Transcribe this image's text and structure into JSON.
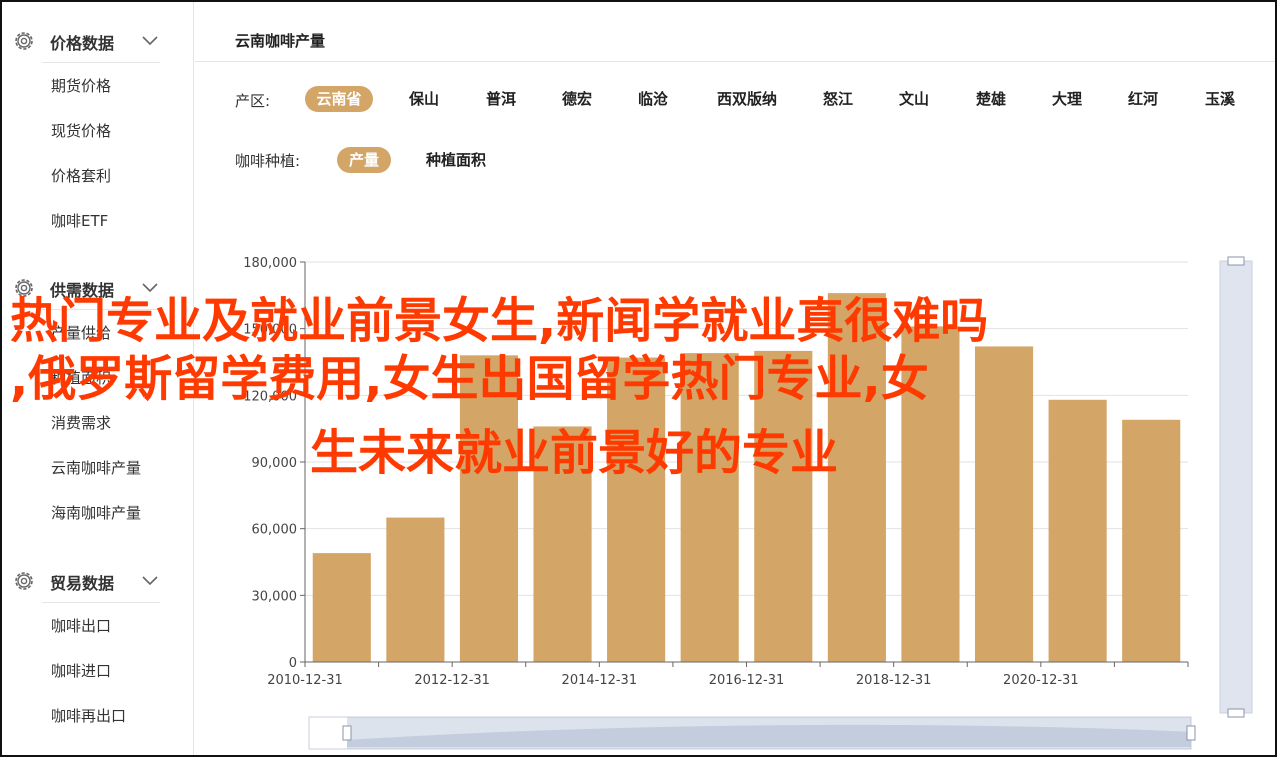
{
  "sidebar": {
    "sections": [
      {
        "title": "价格数据",
        "items": [
          "期货价格",
          "现货价格",
          "价格套利",
          "咖啡ETF"
        ]
      },
      {
        "title": "供需数据",
        "items": [
          "产量供给",
          "种植面积",
          "消费需求",
          "云南咖啡产量",
          "海南咖啡产量"
        ]
      },
      {
        "title": "贸易数据",
        "items": [
          "咖啡出口",
          "咖啡进口",
          "咖啡再出口"
        ]
      }
    ]
  },
  "main": {
    "title": "云南咖啡产量",
    "region_label": "产区:",
    "regions": [
      "云南省",
      "保山",
      "普洱",
      "德宏",
      "临沧",
      "西双版纳",
      "怒江",
      "文山",
      "楚雄",
      "大理",
      "红河",
      "玉溪"
    ],
    "active_region": "云南省",
    "type_label": "咖啡种植:",
    "types": [
      "产量",
      "种植面积"
    ],
    "active_type": "产量"
  },
  "overlay_text": {
    "line1": "热门专业及就业前景女生,新闻学就业真很难吗",
    "line2": ",俄罗斯留学费用,女生出国留学热门专业,女",
    "line3": "生未来就业前景好的专业"
  },
  "colors": {
    "accent": "#d3a667",
    "bar": "#d3a667",
    "overlay": "#ff3a00"
  },
  "chart_data": {
    "type": "bar",
    "categories": [
      "2010-12-31",
      "2011-12-31",
      "2012-12-31",
      "2013-12-31",
      "2014-12-31",
      "2015-12-31",
      "2016-12-31",
      "2017-12-31",
      "2018-12-31",
      "2019-12-31",
      "2020-12-31",
      "2021-12-31"
    ],
    "x_tick_labels": [
      "2010-12-31",
      "2012-12-31",
      "2014-12-31",
      "2016-12-31",
      "2018-12-31",
      "2020-12-31"
    ],
    "values": [
      49000,
      65000,
      138000,
      106000,
      137000,
      139000,
      140000,
      166000,
      151000,
      142000,
      118000,
      109000
    ],
    "ylim": [
      0,
      180000
    ],
    "y_ticks": [
      "0",
      "30,000",
      "60,000",
      "90,000",
      "120,000",
      "150,000",
      "180,000"
    ],
    "y_tick_values": [
      0,
      30000,
      60000,
      90000,
      120000,
      150000,
      180000
    ],
    "grid": true
  }
}
